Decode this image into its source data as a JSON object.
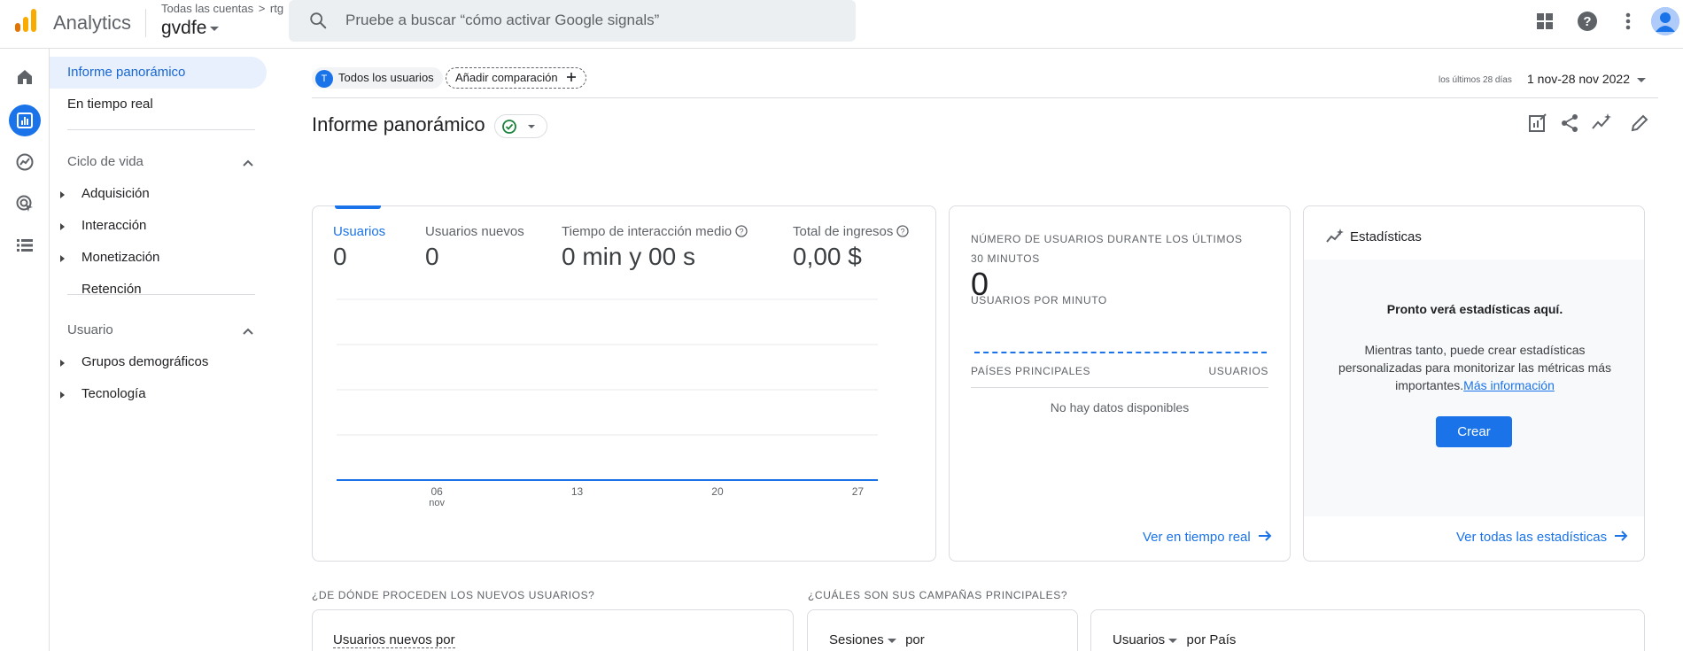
{
  "header": {
    "app_name": "Analytics",
    "breadcrumb_root": "Todas las cuentas",
    "breadcrumb_sep": ">",
    "breadcrumb_account": "rtg",
    "property_name": "gvdfe",
    "search_placeholder": "Pruebe a buscar “cómo activar Google signals”",
    "icons": [
      "apps-icon",
      "help-icon",
      "more-vert-icon",
      "account-avatar"
    ]
  },
  "rail": {
    "items": [
      "home-icon",
      "reports-icon",
      "explore-icon",
      "advertising-icon",
      "configure-icon"
    ],
    "active": "reports-icon"
  },
  "sidenav": {
    "overview": "Informe panorámico",
    "realtime": "En tiempo real",
    "lifecycle": "Ciclo de vida",
    "lifecycle_items": [
      "Adquisición",
      "Interacción",
      "Monetización",
      "Retención"
    ],
    "user": "Usuario",
    "user_items": [
      "Grupos demográficos",
      "Tecnología"
    ]
  },
  "toolbar": {
    "segment_badge": "T",
    "segment_label": "Todos los usuarios",
    "add_comparison": "Añadir comparación",
    "date_label": "los últimos 28 días",
    "date_range": "1 nov-28 nov 2022",
    "page_title": "Informe panorámico"
  },
  "metrics_card": {
    "metrics": [
      {
        "label": "Usuarios",
        "value": "0",
        "selected": true
      },
      {
        "label": "Usuarios nuevos",
        "value": "0",
        "selected": false
      },
      {
        "label": "Tiempo de interacción medio",
        "value": "0 min y 00 s",
        "selected": false
      },
      {
        "label": "Total de ingresos",
        "value": "0,00 $",
        "selected": false
      }
    ],
    "x_ticks": [
      "06",
      "13",
      "20",
      "27"
    ],
    "x_tick_sub": "nov"
  },
  "chart_data": {
    "type": "line",
    "x": [
      "01 nov",
      "02 nov",
      "03 nov",
      "04 nov",
      "05 nov",
      "06 nov",
      "07 nov",
      "08 nov",
      "09 nov",
      "10 nov",
      "11 nov",
      "12 nov",
      "13 nov",
      "14 nov",
      "15 nov",
      "16 nov",
      "17 nov",
      "18 nov",
      "19 nov",
      "20 nov",
      "21 nov",
      "22 nov",
      "23 nov",
      "24 nov",
      "25 nov",
      "26 nov",
      "27 nov",
      "28 nov"
    ],
    "series": [
      {
        "values": [
          0,
          0,
          0,
          0,
          0,
          0,
          0,
          0,
          0,
          0,
          0,
          0,
          0,
          0,
          0,
          0,
          0,
          0,
          0,
          0,
          0,
          0,
          0,
          0,
          0,
          0,
          0,
          0
        ]
      }
    ],
    "x_tick_labels": [
      "06",
      "13",
      "20",
      "27"
    ],
    "grid": true,
    "title": "",
    "xlabel": "",
    "ylabel": ""
  },
  "realtime_card": {
    "heading": "NÚMERO DE USUARIOS DURANTE LOS ÚLTIMOS 30 MINUTOS",
    "value": "0",
    "per_minute": "USUARIOS POR MINUTO",
    "col_countries": "PAÍSES PRINCIPALES",
    "col_users": "USUARIOS",
    "empty": "No hay datos disponibles",
    "link": "Ver en tiempo real"
  },
  "insights_card": {
    "title": "Estadísticas",
    "headline": "Pronto verá estadísticas aquí.",
    "body": "Mientras tanto, puede crear estadísticas personalizadas para monitorizar las métricas más importantes.",
    "more_link": "Más información",
    "create_button": "Crear",
    "link": "Ver todas las estadísticas"
  },
  "bottom": {
    "q1": "¿DE DÓNDE PROCEDEN LOS NUEVOS USUARIOS?",
    "q2": "¿CUÁLES SON SUS CAMPAÑAS PRINCIPALES?",
    "card1_label": "Usuarios nuevos por",
    "card2_label": "Sesiones",
    "card2_suffix": "por",
    "card3_label": "Usuarios",
    "card3_suffix": "por País"
  },
  "colors": {
    "accent": "#1a73e8",
    "analytics_orange": "#f9ab00",
    "analytics_dark_orange": "#e37400"
  }
}
